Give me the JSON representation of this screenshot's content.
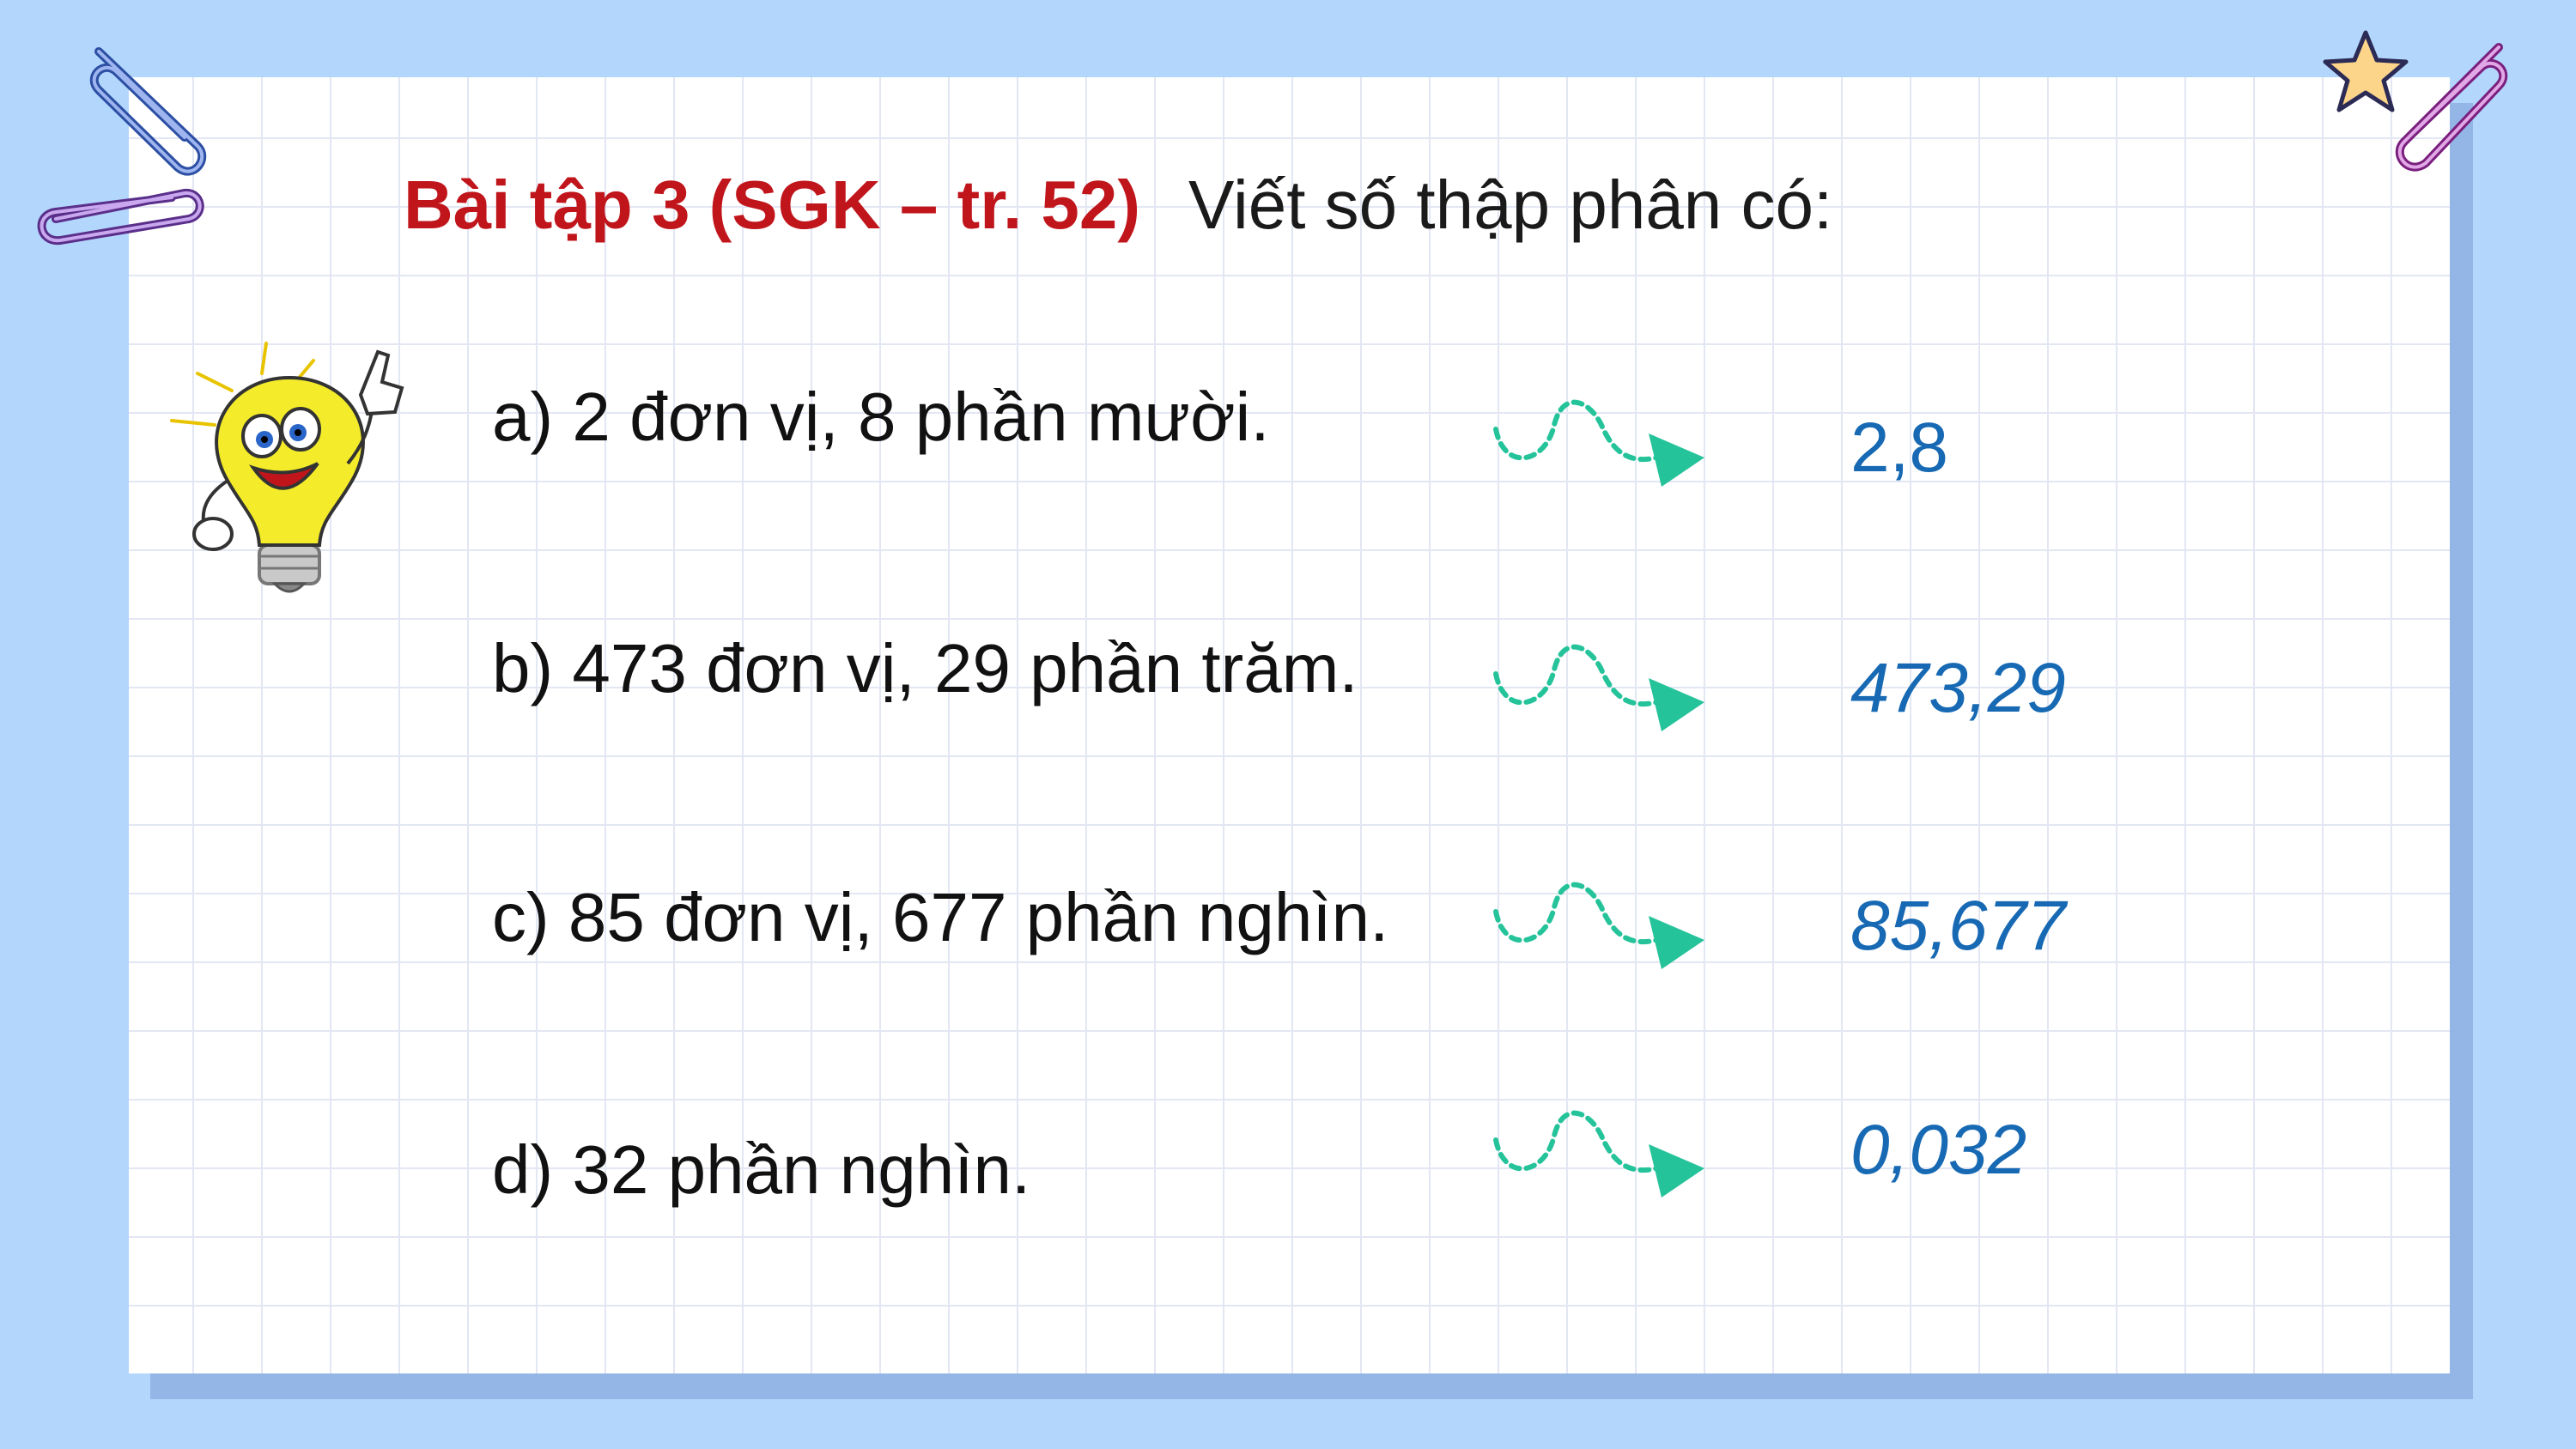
{
  "title": {
    "exercise": "Bài tập 3 (SGK – tr. 52)",
    "instruction": "Viết số thập phân có:"
  },
  "items": [
    {
      "question": "a) 2 đơn vị, 8 phần mười.",
      "answer": "2,8"
    },
    {
      "question": "b) 473 đơn vị, 29 phần trăm.",
      "answer": "473,29"
    },
    {
      "question": "c) 85 đơn vị, 677 phần nghìn.",
      "answer": "85,677"
    },
    {
      "question": "d) 32 phần nghìn.",
      "answer": "0,032"
    }
  ],
  "icons": {
    "arrow": "wavy-dashed-arrow-icon",
    "mascot": "lightbulb-mascot-icon",
    "clip": "paperclip-icon",
    "star": "star-icon"
  },
  "colors": {
    "background": "#b3d6fd",
    "title_red": "#c0151b",
    "answer_blue": "#1769b3",
    "arrow_green": "#25c39a"
  }
}
